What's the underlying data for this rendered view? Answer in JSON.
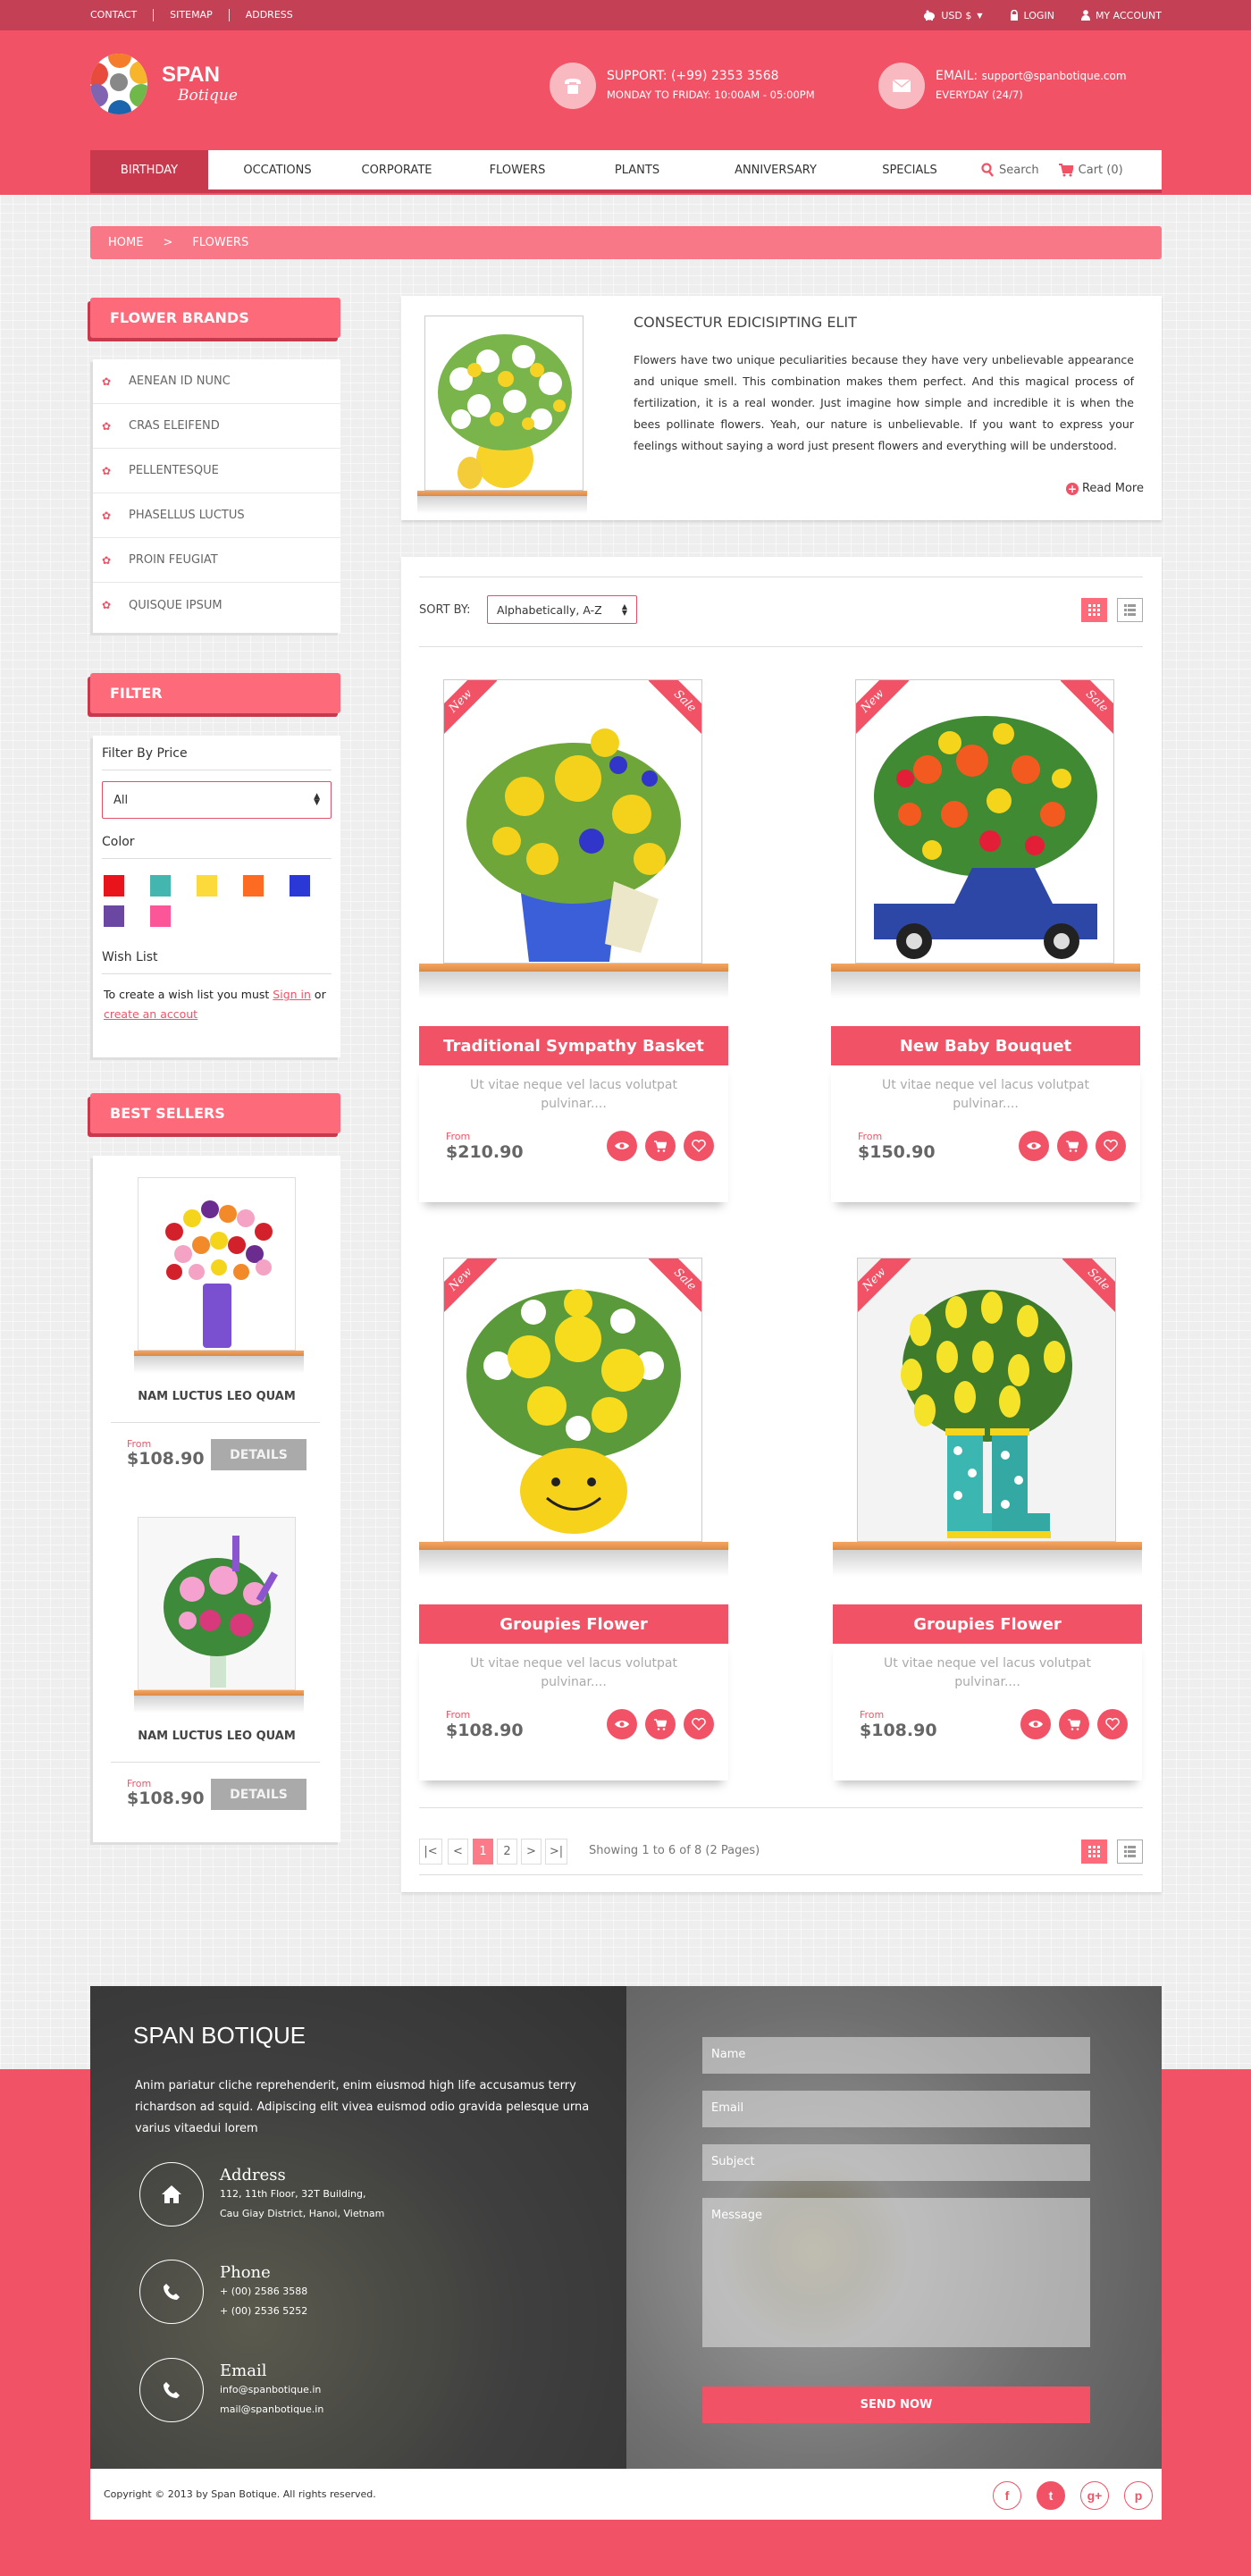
{
  "topbar": {
    "links": [
      "CONTACT",
      "SITEMAP",
      "ADDRESS"
    ],
    "currency": "USD $",
    "login": "LOGIN",
    "account": "MY ACCOUNT"
  },
  "header": {
    "logo_title": "SPAN",
    "logo_subtitle": "Botique",
    "support_label": "SUPPORT:",
    "support_value": "(+99) 2353 3568",
    "support_hours": "MONDAY TO FRIDAY: 10:00AM - 05:00PM",
    "email_label": "EMAIL:",
    "email_value": "support@spanbotique.com",
    "email_hours": "EVERYDAY (24/7)"
  },
  "nav": {
    "items": [
      "BIRTHDAY",
      "OCCATIONS",
      "CORPORATE",
      "FLOWERS",
      "PLANTS",
      "ANNIVERSARY",
      "SPECIALS"
    ],
    "active": "BIRTHDAY",
    "search_label": "Search",
    "cart_label": "Cart (0)"
  },
  "breadcrumb": {
    "home": "HOME",
    "separator": ">",
    "current": "FLOWERS"
  },
  "sidebar": {
    "brands_title": "FLOWER BRANDS",
    "brands": [
      "AENEAN ID NUNC",
      "CRAS ELEIFEND",
      "PELLENTESQUE",
      "PHASELLUS LUCTUS",
      "PROIN FEUGIAT",
      "QUISQUE IPSUM"
    ],
    "filter_title": "FILTER",
    "filter_price_label": "Filter By Price",
    "filter_price_value": "All",
    "color_label": "Color",
    "colors": [
      "#e8131b",
      "#43b6b0",
      "#fdda3b",
      "#fd6a22",
      "#2b38d6",
      "#6b47a4",
      "#fc5598"
    ],
    "wishlist_label": "Wish List",
    "wishlist_text": "To create a wish list you must",
    "wishlist_signin": "Sign in",
    "wishlist_or": "or",
    "wishlist_create": "create an accout",
    "bestsellers_title": "BEST SELLERS",
    "bestsellers": [
      {
        "name": "NAM LUCTUS LEO QUAM",
        "from": "From",
        "price": "$108.90",
        "button": "DETAILS"
      },
      {
        "name": "NAM LUCTUS LEO QUAM",
        "from": "From",
        "price": "$108.90",
        "button": "DETAILS"
      }
    ]
  },
  "intro": {
    "title": "CONSECTUR EDICISIPTING ELIT",
    "text": "Flowers have two unique peculiarities because they have very unbelievable appearance and unique smell. This combination makes them perfect. And this magical process of fertilization, it is a real wonder. Just imagine how simple and incredible it is when the bees pollinate flowers. Yeah, our nature is unbelievable. If you want to express your feelings without saying a word just present flowers and everything will be understood.",
    "read_more": "Read More"
  },
  "listing": {
    "sort_label": "SORT BY:",
    "sort_value": "Alphabetically, A-Z",
    "products": [
      {
        "title": "Traditional Sympathy Basket",
        "desc": "Ut vitae neque vel lacus volutpat pulvinar....",
        "from": "From",
        "price": "$210.90",
        "badge_left": "New",
        "badge_right": "Sale"
      },
      {
        "title": "New Baby Bouquet",
        "desc": "Ut vitae neque vel lacus volutpat pulvinar....",
        "from": "From",
        "price": "$150.90",
        "badge_left": "New",
        "badge_right": "Sale"
      },
      {
        "title": "Groupies Flower",
        "desc": "Ut vitae neque vel lacus volutpat pulvinar....",
        "from": "From",
        "price": "$108.90",
        "badge_left": "New",
        "badge_right": "Sale"
      },
      {
        "title": "Groupies Flower",
        "desc": "Ut vitae neque vel lacus volutpat pulvinar....",
        "from": "From",
        "price": "$108.90",
        "badge_left": "New",
        "badge_right": "Sale"
      }
    ],
    "pagination": {
      "first": "|<",
      "prev": "<",
      "pages": [
        "1",
        "2"
      ],
      "active_page": "1",
      "next": ">",
      "last": ">|",
      "summary": "Showing 1 to 6 of 8 (2 Pages)"
    }
  },
  "footer": {
    "title": "SPAN BOTIQUE",
    "text": "Anim pariatur cliche reprehenderit, enim eiusmod high life accusamus terry richardson ad squid. Adipiscing elit vivea euismod odio gravida pelesque urna varius vitaedui lorem",
    "address_label": "Address",
    "address_lines": [
      "112, 11th Floor, 32T Building,",
      "Cau Giay District, Hanoi, Vietnam"
    ],
    "phone_label": "Phone",
    "phone_lines": [
      "+ (00) 2586 3588",
      "+ (00) 2536 5252"
    ],
    "email_label": "Email",
    "email_lines": [
      "info@spanbotique.in",
      "mail@spanbotique.in"
    ],
    "form": {
      "name_ph": "Name",
      "email_ph": "Email",
      "subject_ph": "Subject",
      "message_ph": "Message",
      "send": "SEND NOW"
    },
    "copyright": "Copyright © 2013 by Span Botique.  All rights reserved.",
    "social": [
      "f",
      "t",
      "g+",
      "p"
    ]
  },
  "colors": {
    "brand": "#f25266",
    "dark": "#c44055",
    "light_pink": "#fd6b7b"
  }
}
